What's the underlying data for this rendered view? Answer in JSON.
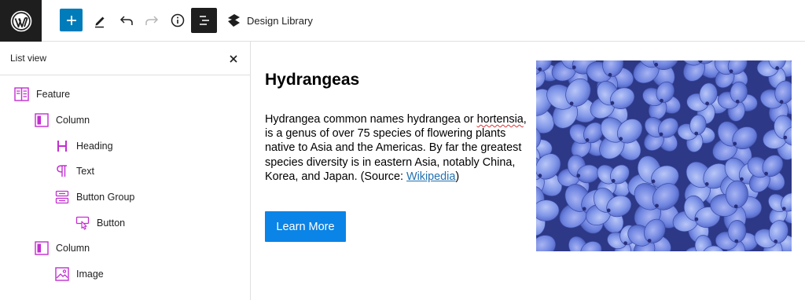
{
  "toolbar": {
    "design_library_label": "Design Library"
  },
  "sidebar": {
    "title": "List view",
    "items": [
      {
        "label": "Feature",
        "icon": "feature-icon"
      },
      {
        "label": "Column",
        "icon": "column-icon"
      },
      {
        "label": "Heading",
        "icon": "heading-icon"
      },
      {
        "label": "Text",
        "icon": "paragraph-icon"
      },
      {
        "label": "Button Group",
        "icon": "button-group-icon"
      },
      {
        "label": "Button",
        "icon": "button-icon"
      },
      {
        "label": "Column",
        "icon": "column-icon"
      },
      {
        "label": "Image",
        "icon": "image-icon"
      }
    ]
  },
  "content": {
    "heading": "Hydrangeas",
    "para_1": "Hydrangea common names hydrangea or ",
    "para_2": "hortensia",
    "para_3": ", is a genus of over 75 species of flowering plants native to Asia and the Americas. By far the greatest species diversity is in eastern Asia, notably China, Korea, and Japan. (Source: ",
    "para_link": "Wikipedia",
    "para_end": ")",
    "button_label": "Learn More"
  },
  "colors": {
    "accent": "#007cba",
    "button": "#0a84e6",
    "block_icon": "#c22ed0",
    "link": "#2271b1"
  }
}
